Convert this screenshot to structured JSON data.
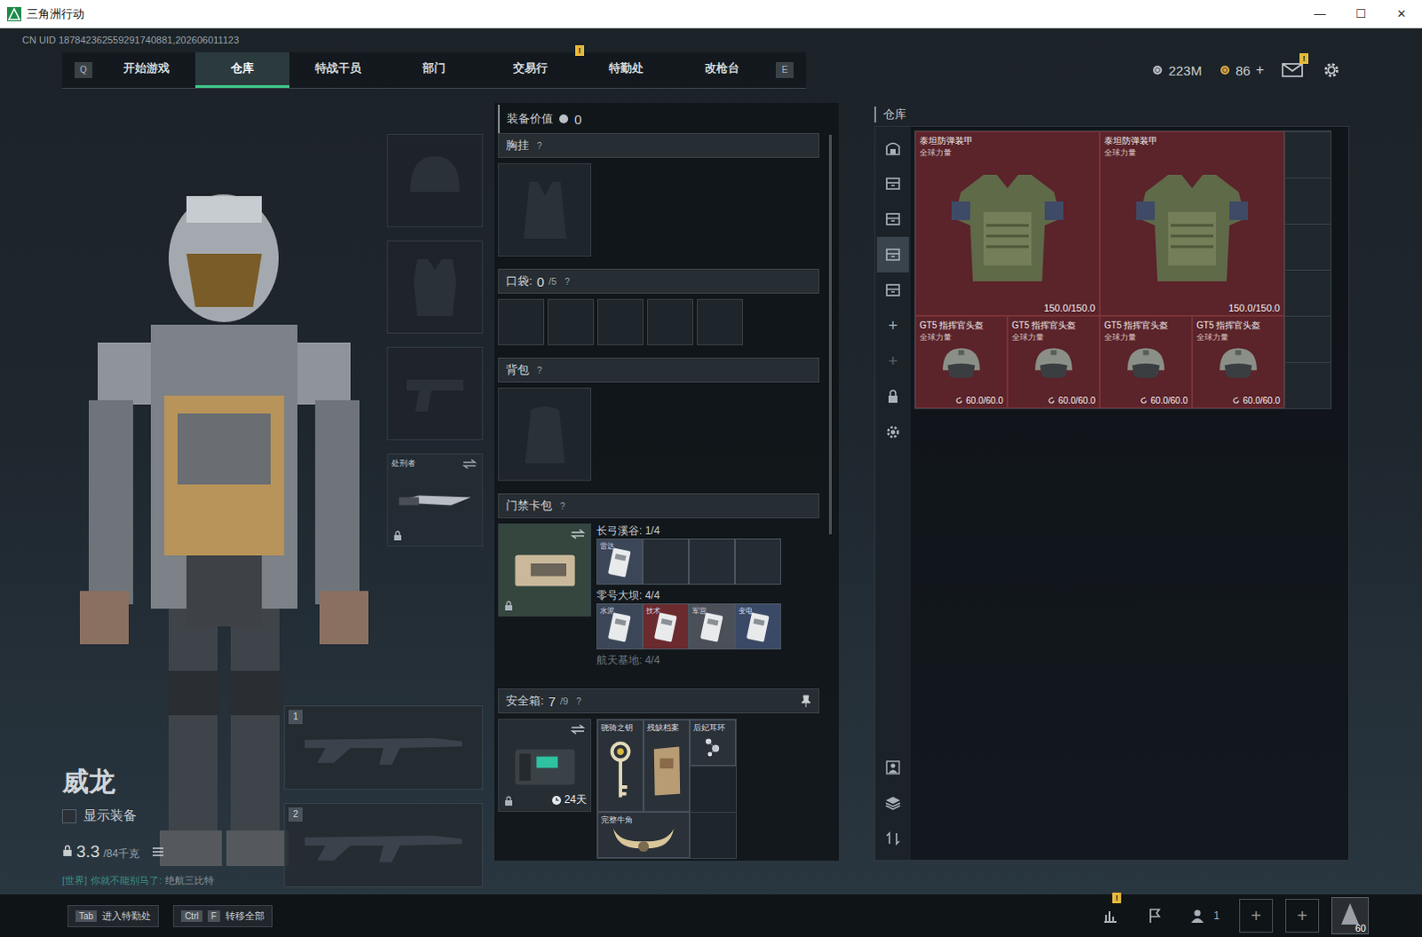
{
  "window": {
    "title": "三角洲行动",
    "controls": [
      "—",
      "☐",
      "✕"
    ]
  },
  "uid": "CN UID 187842362559291740881,202606011123",
  "nav": {
    "prev_key": "Q",
    "next_key": "E",
    "tabs": [
      {
        "label": "开始游戏",
        "selected": false,
        "badge": ""
      },
      {
        "label": "仓库",
        "selected": true,
        "badge": ""
      },
      {
        "label": "特战干员",
        "selected": false,
        "badge": ""
      },
      {
        "label": "部门",
        "selected": false,
        "badge": ""
      },
      {
        "label": "交易行",
        "selected": false,
        "badge": ""
      },
      {
        "label": "特勤处",
        "selected": false,
        "badge": "!"
      },
      {
        "label": "改枪台",
        "selected": false,
        "badge": ""
      }
    ]
  },
  "currencies": [
    {
      "amount": "223M",
      "plus": "",
      "color": "#b9c0c6"
    },
    {
      "amount": "86",
      "plus": "+",
      "color": "#d9a441"
    }
  ],
  "mail": {
    "badge": "!"
  },
  "character": {
    "name": "威龙",
    "show_equipment": {
      "label": "显示装备",
      "checked": false
    },
    "weight": "3.3",
    "capacity": "/84千克"
  },
  "chat": {
    "channel": "[世界]",
    "message": "你就不能别马了:",
    "sender": "绝航三比特"
  },
  "gear_slots": [
    {
      "kind": "helmet",
      "filled": false,
      "label": "",
      "swap": false,
      "locked": false
    },
    {
      "kind": "armor",
      "filled": false,
      "label": "",
      "swap": false,
      "locked": false
    },
    {
      "kind": "pistol",
      "filled": false,
      "label": "",
      "swap": false,
      "locked": false
    },
    {
      "kind": "melee",
      "filled": true,
      "label": "处刑者",
      "swap": true,
      "locked": true
    }
  ],
  "weapon_slots": [
    {
      "number": "1"
    },
    {
      "number": "2"
    }
  ],
  "loadout": {
    "value_label": "装备价值",
    "value": "0",
    "chest": {
      "title": "胸挂",
      "help": "?"
    },
    "pockets": {
      "title": "口袋:",
      "used": "0",
      "total": "/5",
      "help": "?",
      "slots": [
        {
          "filled": false
        },
        {
          "filled": false
        },
        {
          "filled": false
        },
        {
          "filled": false
        },
        {
          "filled": false
        }
      ]
    },
    "backpack": {
      "title": "背包",
      "help": "?"
    },
    "keycards": {
      "title": "门禁卡包",
      "help": "?",
      "maps": [
        {
          "name": "长弓溪谷:",
          "count": "1/4",
          "cards": [
            {
              "label": "雷达",
              "filled": true,
              "color": "#3b4658"
            },
            {
              "label": "",
              "filled": false,
              "color": "#252c33"
            },
            {
              "label": "",
              "filled": false,
              "color": "#252c33"
            },
            {
              "label": "",
              "filled": false,
              "color": "#252c33"
            }
          ]
        },
        {
          "name": "零号大坝:",
          "count": "4/4",
          "cards": [
            {
              "label": "水泥",
              "filled": true,
              "color": "#3b4658"
            },
            {
              "label": "技术",
              "filled": true,
              "color": "#6b2a2e"
            },
            {
              "label": "军营",
              "filled": true,
              "color": "#4a4f58"
            },
            {
              "label": "变电",
              "filled": true,
              "color": "#3a4a66"
            }
          ]
        },
        {
          "name": "航天基地:",
          "count": "4/4",
          "cards": []
        }
      ]
    },
    "secure_case": {
      "title": "安全箱:",
      "used": "7",
      "total": "/9",
      "help": "?",
      "timer": "24天",
      "items": [
        {
          "label": "骁骑之钥",
          "kind": "key"
        },
        {
          "label": "残缺档案",
          "kind": "document"
        },
        {
          "label": "后妃耳环",
          "kind": "earring"
        },
        {
          "label": "完整牛角",
          "kind": "horn"
        }
      ]
    }
  },
  "warehouse": {
    "title": "仓库",
    "tabs": [
      {
        "kind": "store",
        "glyph": "",
        "selected": false,
        "disabled": false
      },
      {
        "kind": "case",
        "glyph": "",
        "selected": false,
        "disabled": false
      },
      {
        "kind": "case",
        "glyph": "",
        "selected": false,
        "disabled": false
      },
      {
        "kind": "case",
        "glyph": "",
        "selected": true,
        "disabled": false
      },
      {
        "kind": "case",
        "glyph": "",
        "selected": false,
        "disabled": false
      },
      {
        "kind": "add",
        "glyph": "+",
        "selected": false,
        "disabled": false
      },
      {
        "kind": "add",
        "glyph": "+",
        "selected": false,
        "disabled": true
      },
      {
        "kind": "lock",
        "glyph": "",
        "selected": false,
        "disabled": false
      },
      {
        "kind": "gear",
        "glyph": "",
        "selected": false,
        "disabled": false
      }
    ],
    "tools": [
      {
        "kind": "person"
      },
      {
        "kind": "layers"
      },
      {
        "kind": "sort"
      }
    ],
    "items": [
      {
        "kind": "armor",
        "name": "泰坦防弹装甲",
        "tag": "全球力量",
        "durability": "150.0/150.0"
      },
      {
        "kind": "armor",
        "name": "泰坦防弹装甲",
        "tag": "全球力量",
        "durability": "150.0/150.0"
      },
      {
        "kind": "helmet",
        "name": "GT5 指挥官头盔",
        "tag": "全球力量",
        "durability": "60.0/60.0"
      },
      {
        "kind": "helmet",
        "name": "GT5 指挥官头盔",
        "tag": "全球力量",
        "durability": "60.0/60.0"
      },
      {
        "kind": "helmet",
        "name": "GT5 指挥官头盔",
        "tag": "全球力量",
        "durability": "60.0/60.0"
      },
      {
        "kind": "helmet",
        "name": "GT5 指挥官头盔",
        "tag": "全球力量",
        "durability": "60.0/60.0"
      }
    ]
  },
  "bottom_bar": {
    "hints": [
      {
        "keys": [
          "Tab"
        ],
        "label": "进入特勤处"
      },
      {
        "keys": [
          "Ctrl",
          "F"
        ],
        "label": "转移全部"
      }
    ],
    "stats_badge": "!",
    "friends": "1",
    "plus_slots": [
      "+",
      "+"
    ],
    "level": "60"
  }
}
